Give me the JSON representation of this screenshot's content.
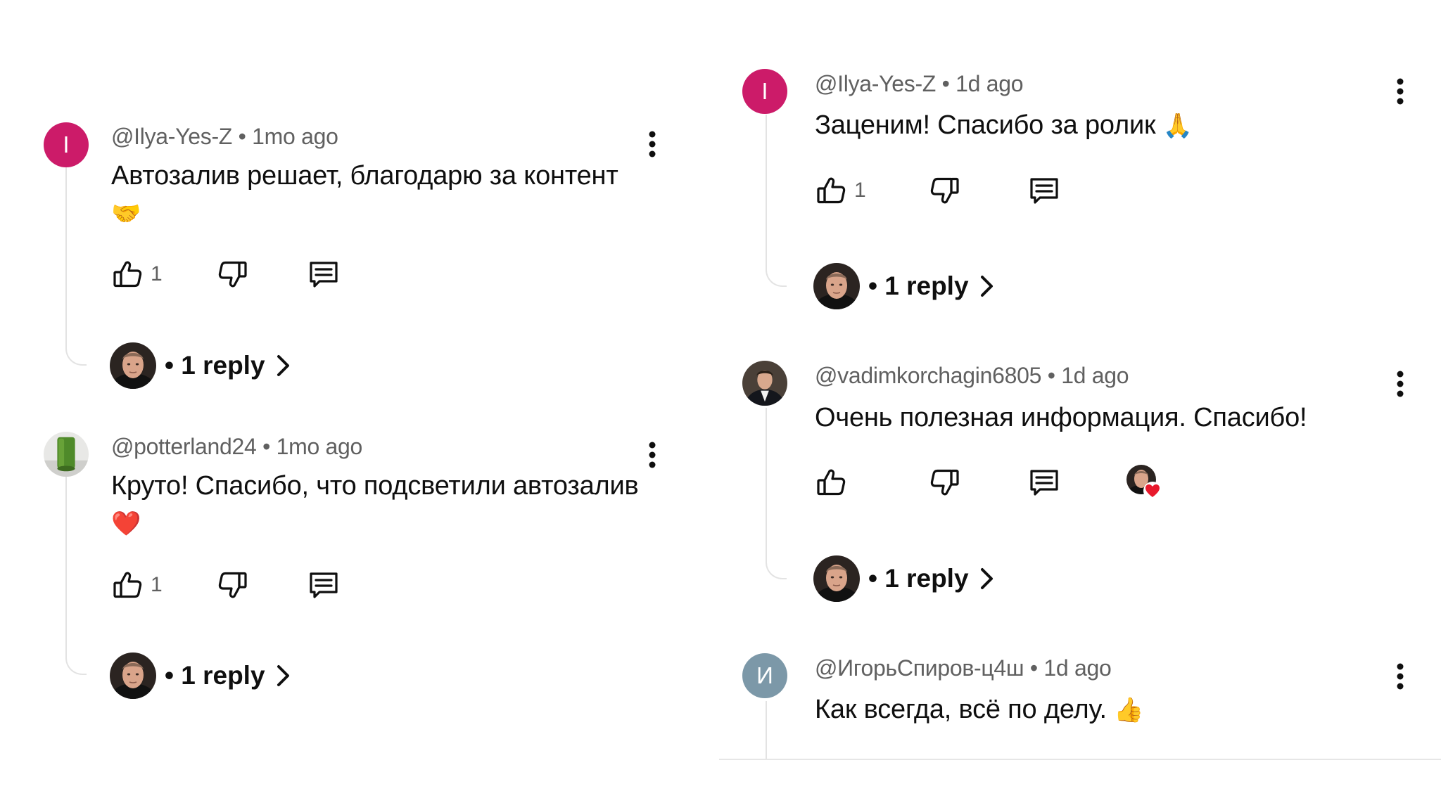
{
  "left_column": {
    "comments": [
      {
        "author": "@Ilya-Yes-Z",
        "time": "1mo ago",
        "avatar_letter": "I",
        "text": "Автозалив решает, благодарю за контент",
        "emoji": "🤝",
        "likes": "1",
        "replies": "• 1 reply"
      },
      {
        "author": "@potterland24",
        "time": "1mo ago",
        "text": "Круто! Спасибо, что подсветили автозалив",
        "emoji": "❤️",
        "likes": "1",
        "replies": "• 1 reply"
      }
    ]
  },
  "right_column": {
    "comments": [
      {
        "author": "@Ilya-Yes-Z",
        "time": "1d ago",
        "avatar_letter": "I",
        "text": "Заценим! Спасибо за ролик",
        "emoji": "🙏",
        "likes": "1",
        "replies": "• 1 reply"
      },
      {
        "author": "@vadimkorchagin6805",
        "time": "1d ago",
        "text": "Очень полезная информация. Спасибо!",
        "replies": "• 1 reply"
      },
      {
        "author": "@ИгорьСпиров-ц4ш",
        "time": "1d ago",
        "avatar_letter": "И",
        "text": "Как всегда, всё по делу.",
        "emoji": "👍"
      }
    ]
  },
  "separator": "•",
  "colors": {
    "avatar_ilya": "#cc1b69",
    "avatar_igor": "#7c98a8",
    "heart": "#e8192c",
    "icon": "#0f0f0f",
    "meta_text": "#606060",
    "thread_line": "#e3e3e3"
  },
  "icons": [
    "like-icon",
    "dislike-icon",
    "reply-icon",
    "more-vert-icon",
    "chevron-right-icon",
    "heart-icon"
  ]
}
